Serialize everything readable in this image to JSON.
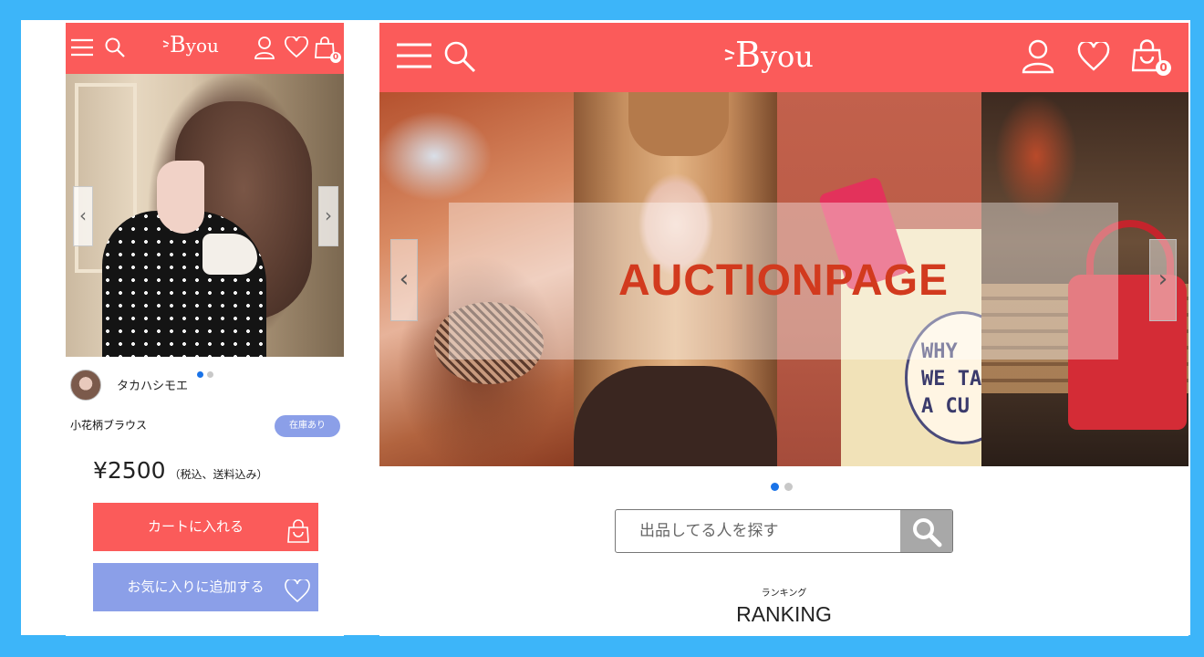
{
  "brand": {
    "logo_text": "B",
    "logo_suffix": "you",
    "header_color": "#fb5b5a",
    "background_color": "#3db5f9"
  },
  "mobile": {
    "header": {
      "icons": [
        "menu-icon",
        "search-icon",
        "user-icon",
        "heart-icon",
        "shopping-bag-icon"
      ],
      "cart_count": "0"
    },
    "gallery": {
      "prev_glyph": "‹",
      "next_glyph": "›",
      "slide_count": 2,
      "active_slide": 1
    },
    "seller": {
      "name": "タカハシモエ"
    },
    "product": {
      "name": "小花柄ブラウス",
      "stock_badge": "在庫あり",
      "price": "¥2500",
      "price_note": "（税込、送料込み）"
    },
    "buttons": {
      "add_to_cart": "カートに入れる",
      "add_to_favorites": "お気に入りに追加する"
    },
    "colors": {
      "cart_button": "#fb5b5a",
      "favorite_button": "#8b9fe8"
    }
  },
  "desktop": {
    "header": {
      "icons": [
        "menu-icon",
        "search-icon",
        "user-icon",
        "heart-icon",
        "shopping-bag-icon"
      ],
      "cart_count": "0"
    },
    "banner": {
      "title": "AUCTIONPAGE",
      "prev_glyph": "‹",
      "next_glyph": "›",
      "bag_text": "WHY\nWE TA\nA CU",
      "slide_count": 2,
      "active_slide": 1
    },
    "search": {
      "placeholder": "出品してる人を探す",
      "value": ""
    },
    "ranking": {
      "subtitle": "ランキング",
      "title": "RANKING"
    }
  }
}
